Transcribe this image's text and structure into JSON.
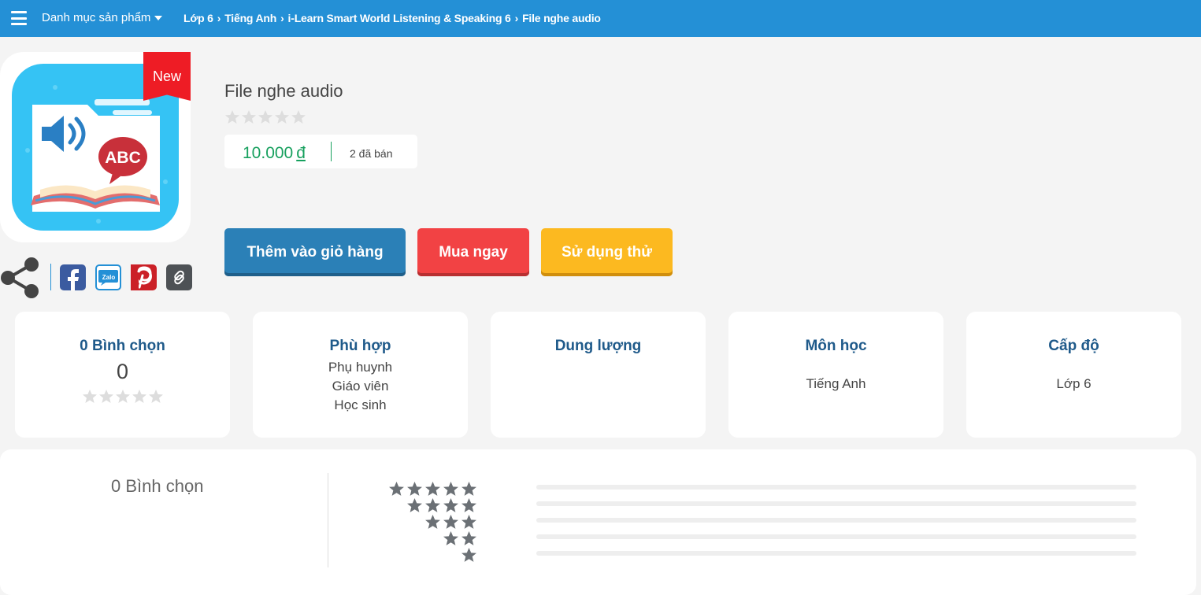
{
  "header": {
    "catalog_label": "Danh mục sản phẩm",
    "breadcrumb": [
      "Lớp 6",
      "Tiếng Anh",
      "i-Learn Smart World Listening & Speaking 6",
      "File nghe audio"
    ]
  },
  "product": {
    "badge": "New",
    "image_text": "ABC",
    "title": "File nghe audio",
    "rating_stars": 0,
    "price": "10.000",
    "currency": "đ",
    "sold": "2 đã bán"
  },
  "buttons": {
    "add_to_cart": "Thêm vào giỏ hàng",
    "buy_now": "Mua ngay",
    "try": "Sử dụng thử"
  },
  "share": {
    "icons": [
      "share-icon",
      "facebook-icon",
      "zalo-icon",
      "pinterest-icon",
      "link-icon"
    ],
    "zalo_label": "Zalo"
  },
  "cards": {
    "votes": {
      "title": "0 Bình chọn",
      "value": "0"
    },
    "audience": {
      "title": "Phù hợp",
      "items": [
        "Phụ huynh",
        "Giáo viên",
        "Học sinh"
      ]
    },
    "size": {
      "title": "Dung lượng"
    },
    "subject": {
      "title": "Môn học",
      "value": "Tiếng Anh"
    },
    "level": {
      "title": "Cấp độ",
      "value": "Lớp 6"
    }
  },
  "rating_summary": {
    "label": "0 Bình chọn",
    "rows": [
      {
        "stars": 5,
        "fraction": 0
      },
      {
        "stars": 4,
        "fraction": 0
      },
      {
        "stars": 3,
        "fraction": 0
      },
      {
        "stars": 2,
        "fraction": 0
      },
      {
        "stars": 1,
        "fraction": 0
      }
    ]
  },
  "colors": {
    "topbar": "#2490d6",
    "price": "#17a05e",
    "cart_button": "#2b80b7",
    "buy_button": "#f24244",
    "try_button": "#fcb920",
    "card_title": "#1f5a8a",
    "badge": "#ee1c25"
  }
}
